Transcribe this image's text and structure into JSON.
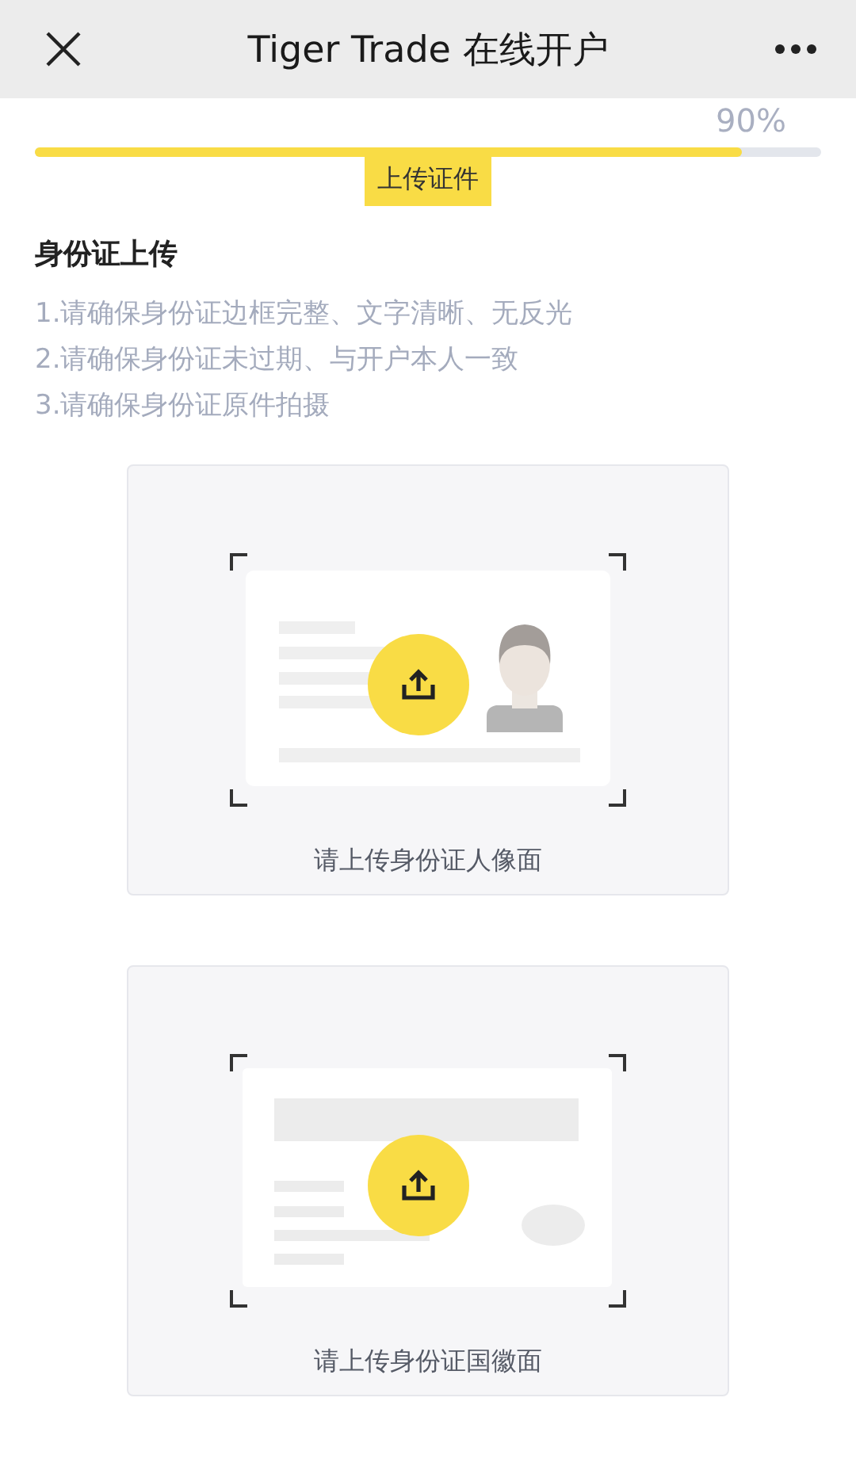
{
  "header": {
    "title": "Tiger Trade 在线开户"
  },
  "progress": {
    "percent": "90%",
    "level": 0.9,
    "step": "上传证件"
  },
  "section": {
    "title": "身份证上传",
    "tips": [
      "1.请确保身份证边框完整、文字清晰、无反光",
      "2.请确保身份证未过期、与开户本人一致",
      "3.请确保身份证原件拍摄"
    ]
  },
  "uploads": [
    {
      "kind": "portrait",
      "label": "请上传身份证人像面"
    },
    {
      "kind": "emblem",
      "label": "请上传身份证国徽面"
    }
  ]
}
